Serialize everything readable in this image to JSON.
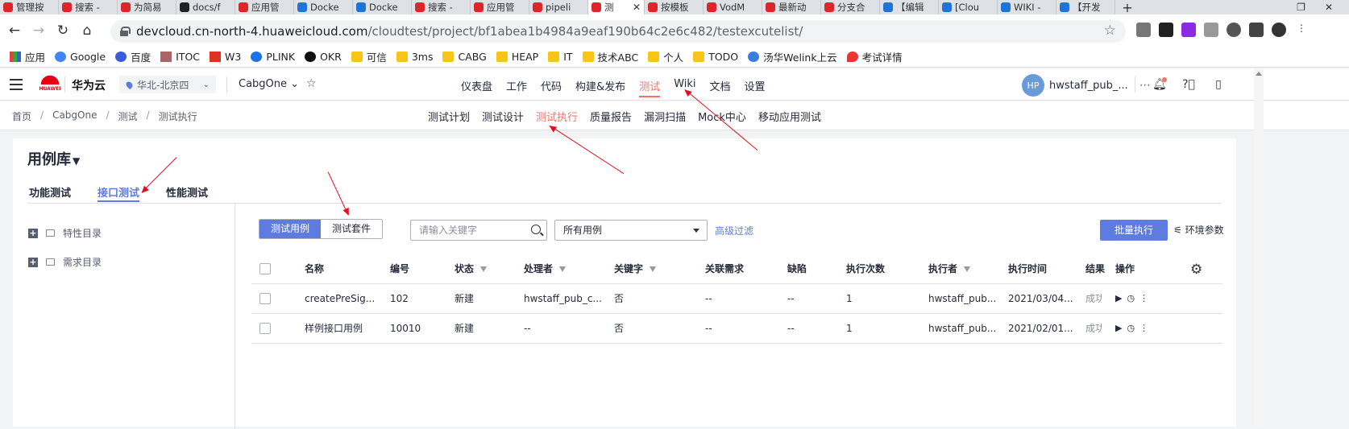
{
  "browser": {
    "tabs": [
      {
        "title": "管理按",
        "icon": "huawei-favicon"
      },
      {
        "title": "搜索 -",
        "icon": "huawei-favicon"
      },
      {
        "title": "为简易",
        "icon": "huawei-favicon"
      },
      {
        "title": "docs/f",
        "icon": "github-favicon"
      },
      {
        "title": "应用管",
        "icon": "huawei-favicon"
      },
      {
        "title": "Docke",
        "icon": "edge-favicon"
      },
      {
        "title": "Docke",
        "icon": "edge-favicon"
      },
      {
        "title": "搜索 -",
        "icon": "huawei-favicon"
      },
      {
        "title": "应用管",
        "icon": "huawei-favicon"
      },
      {
        "title": "pipeli",
        "icon": "huawei-favicon"
      },
      {
        "title": "测",
        "icon": "huawei-favicon",
        "active": true
      },
      {
        "title": "按模板",
        "icon": "huawei-favicon"
      },
      {
        "title": "VodM",
        "icon": "huawei-favicon"
      },
      {
        "title": "最新动",
        "icon": "huawei-favicon"
      },
      {
        "title": "分支合",
        "icon": "huawei-favicon"
      },
      {
        "title": "【编辑",
        "icon": "wiki-favicon"
      },
      {
        "title": "[Clou",
        "icon": "wiki-favicon"
      },
      {
        "title": "WIKI -",
        "icon": "wiki-favicon"
      },
      {
        "title": "【开发",
        "icon": "wiki-favicon"
      }
    ],
    "new_tab": "+",
    "url_host": "devcloud.cn-north-4.huaweicloud.com",
    "url_path": "/cloudtest/project/bf1abea1b4984a9eaf190b64c2e6c482/testexcutelist/",
    "bookmarks": [
      {
        "label": "应用",
        "icon": "apps-icon"
      },
      {
        "label": "Google",
        "icon": "google-icon"
      },
      {
        "label": "百度",
        "icon": "baidu-icon"
      },
      {
        "label": "ITOC",
        "icon": "itoc-icon"
      },
      {
        "label": "W3",
        "icon": "w3-icon"
      },
      {
        "label": "PLINK",
        "icon": "plink-icon"
      },
      {
        "label": "OKR",
        "icon": "okr-icon"
      },
      {
        "label": "可信",
        "icon": "folder-icon"
      },
      {
        "label": "3ms",
        "icon": "folder-icon"
      },
      {
        "label": "CABG",
        "icon": "folder-icon"
      },
      {
        "label": "HEAP",
        "icon": "folder-icon"
      },
      {
        "label": "IT",
        "icon": "folder-icon"
      },
      {
        "label": "技术ABC",
        "icon": "folder-icon"
      },
      {
        "label": "个人",
        "icon": "folder-icon"
      },
      {
        "label": "TODO",
        "icon": "folder-icon"
      },
      {
        "label": "汤华Welink上云",
        "icon": "cloud-icon"
      },
      {
        "label": "考试详情",
        "icon": "pin-icon"
      }
    ]
  },
  "header": {
    "logo_text": "HUAWEI",
    "brand": "华为云",
    "region": "华北-北京四",
    "project": "CabgOne",
    "nav": [
      "仪表盘",
      "工作",
      "代码",
      "构建&发布",
      "测试",
      "Wiki",
      "文档",
      "设置"
    ],
    "nav_active": "测试",
    "user_initials": "HP",
    "user_name": "hwstaff_pub_..."
  },
  "breadcrumb": [
    "首页",
    "CabgOne",
    "测试",
    "测试执行"
  ],
  "subnav": [
    "测试计划",
    "测试设计",
    "测试执行",
    "质量报告",
    "漏洞扫描",
    "Mock中心",
    "移动应用测试"
  ],
  "subnav_active": "测试执行",
  "library": {
    "title": "用例库",
    "tabs": [
      "功能测试",
      "接口测试",
      "性能测试"
    ],
    "active_tab": "接口测试",
    "tree": [
      "特性目录",
      "需求目录"
    ]
  },
  "toolbar": {
    "segments": [
      "测试用例",
      "测试套件"
    ],
    "active_segment": "测试用例",
    "search_placeholder": "请输入关键字",
    "filter_select": "所有用例",
    "advanced_filter": "高级过滤",
    "batch_execute": "批量执行",
    "env_params": "环境参数"
  },
  "table": {
    "columns": [
      "名称",
      "编号",
      "状态",
      "处理者",
      "关键字",
      "关联需求",
      "缺陷",
      "执行次数",
      "执行者",
      "执行时间",
      "结果",
      "操作"
    ],
    "rows": [
      [
        "createPreSig...",
        "102",
        "新建",
        "hwstaff_pub_c...",
        "否",
        "--",
        "--",
        "1",
        "hwstaff_pub...",
        "2021/03/04...",
        "成功"
      ],
      [
        "样例接口用例",
        "10010",
        "新建",
        "--",
        "否",
        "--",
        "--",
        "1",
        "hwstaff_pub...",
        "2021/02/01...",
        "成功"
      ]
    ]
  },
  "colors": {
    "accent": "#5e7ce0",
    "active_red": "#f66f6a",
    "annotation": "#e0101e"
  }
}
